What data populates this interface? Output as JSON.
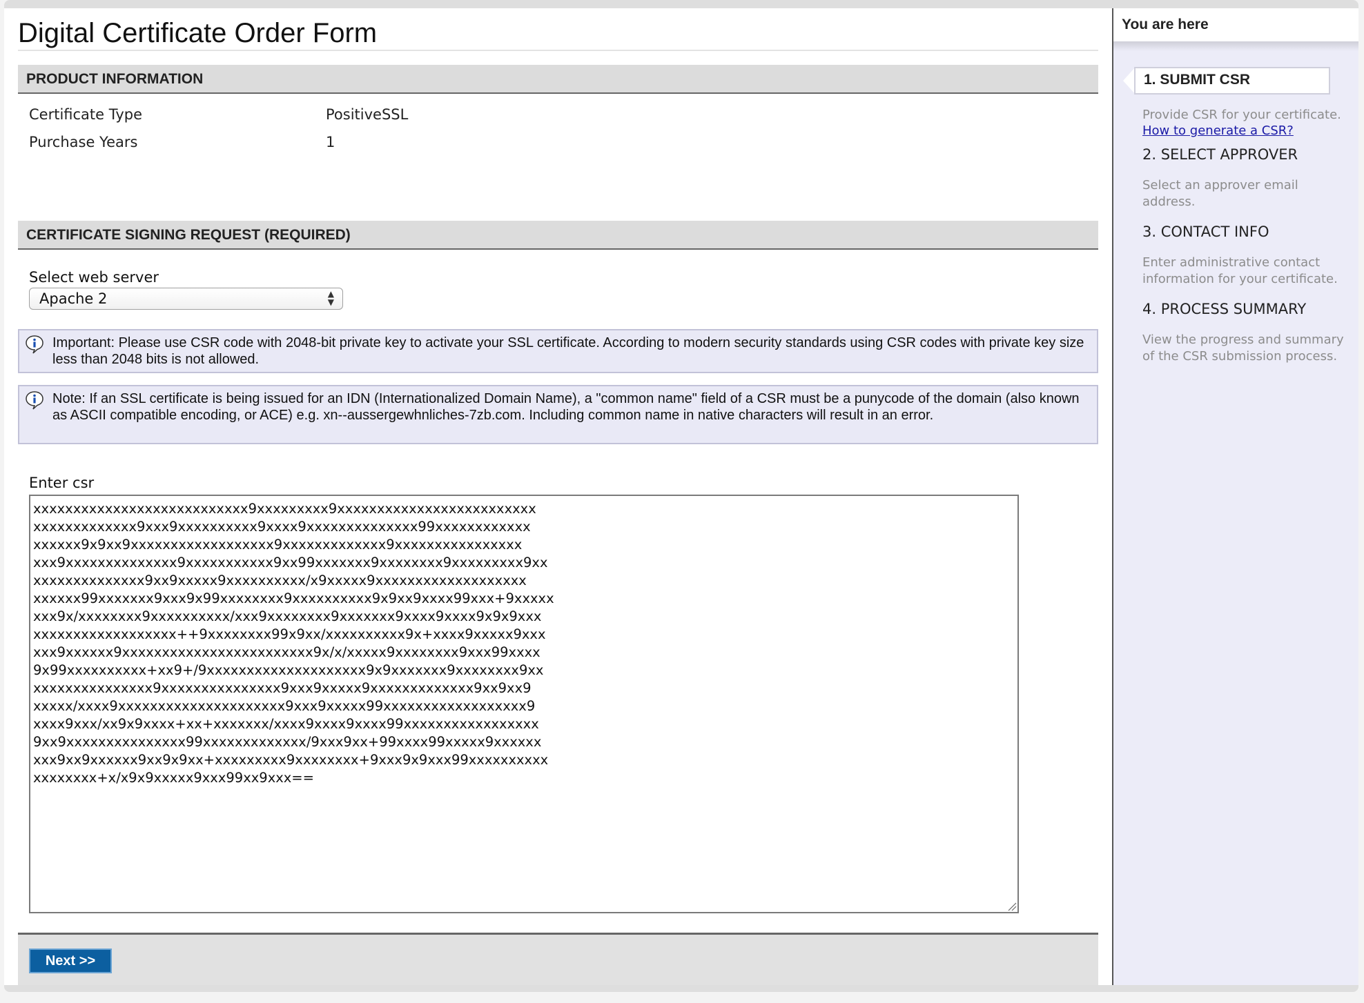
{
  "page": {
    "title": "Digital Certificate Order Form"
  },
  "product_info": {
    "header": "PRODUCT INFORMATION",
    "rows": [
      {
        "label": "Certificate Type",
        "value": "PositiveSSL"
      },
      {
        "label": "Purchase Years",
        "value": "1"
      }
    ]
  },
  "csr": {
    "header": "CERTIFICATE SIGNING REQUEST (REQUIRED)",
    "web_server_label": "Select web server",
    "web_server_value": "Apache 2",
    "important_note": "Important: Please use CSR code with 2048-bit private key to activate your SSL certificate. According to modern security standards using CSR codes with private key size less than 2048 bits is not allowed.",
    "idn_note": "Note: If an SSL certificate is being issued for an IDN (Internationalized Domain Name), a \"common name\" field of a CSR must be a punycode of the domain (also known as ASCII compatible encoding, or ACE) e.g. xn--aussergewhnliches-7zb.com. Including common name in native characters will result in an error.",
    "enter_label": "Enter csr",
    "value": "xxxxxxxxxxxxxxxxxxxxxxxxxxx9xxxxxxxxx9xxxxxxxxxxxxxxxxxxxxxxxxx\nxxxxxxxxxxxxx9xxx9xxxxxxxxxx9xxxx9xxxxxxxxxxxxxx99xxxxxxxxxxxx\nxxxxxx9x9xx9xxxxxxxxxxxxxxxxxx9xxxxxxxxxxxxx9xxxxxxxxxxxxxxxx\nxxx9xxxxxxxxxxxxxx9xxxxxxxxxxx9xx99xxxxxxx9xxxxxxxx9xxxxxxxxx9xx\nxxxxxxxxxxxxxx9xx9xxxxx9xxxxxxxxxx/x9xxxxx9xxxxxxxxxxxxxxxxxxx\nxxxxxx99xxxxxxx9xxx9x99xxxxxxxx9xxxxxxxxxx9x9xx9xxxx99xxx+9xxxxx\nxxx9x/xxxxxxxx9xxxxxxxxxx/xxx9xxxxxxxx9xxxxxxx9xxxx9xxxx9x9x9xxx\nxxxxxxxxxxxxxxxxxx++9xxxxxxxx99x9xx/xxxxxxxxxx9x+xxxx9xxxxx9xxx\nxxx9xxxxxx9xxxxxxxxxxxxxxxxxxxxxxxx9x/x/xxxxx9xxxxxxxx9xxx99xxxx\n9x99xxxxxxxxxx+xx9+/9xxxxxxxxxxxxxxxxxxxx9x9xxxxxxx9xxxxxxxx9xx\nxxxxxxxxxxxxxxx9xxxxxxxxxxxxxxx9xxx9xxxxx9xxxxxxxxxxxxx9xx9xx9\nxxxxx/xxxx9xxxxxxxxxxxxxxxxxxxxx9xxx9xxxxx99xxxxxxxxxxxxxxxxxx9\nxxxx9xxx/xx9x9xxxx+xx+xxxxxxx/xxxx9xxxx9xxxx99xxxxxxxxxxxxxxxxx\n9xx9xxxxxxxxxxxxxxx99xxxxxxxxxxxxx/9xxx9xx+99xxxx99xxxxx9xxxxxx\nxxx9xx9xxxxxx9xx9x9xx+xxxxxxxxx9xxxxxxxx+9xxx9x9xxx99xxxxxxxxxx\nxxxxxxxx+x/x9x9xxxxx9xxx99xx9xxx=="
  },
  "footer": {
    "next_label": "Next >>"
  },
  "sidebar": {
    "title": "You are here",
    "steps": [
      {
        "title": "1. SUBMIT CSR",
        "desc": "Provide CSR for your certificate.",
        "link": "How to generate a CSR?"
      },
      {
        "title": "2. SELECT APPROVER",
        "desc": "Select an approver email address."
      },
      {
        "title": "3. CONTACT INFO",
        "desc": "Enter administrative contact information for your certificate."
      },
      {
        "title": "4. PROCESS SUMMARY",
        "desc": "View the progress and summary of the CSR submission process."
      }
    ]
  },
  "colors": {
    "accent": "#0c5fa0",
    "sidebar_bg": "#ececf8",
    "notice_bg": "#e9e9f6",
    "link": "#1a1aa6"
  },
  "icons": {
    "info": "info-speech-bubble-icon",
    "select": "updown-arrows-icon"
  }
}
